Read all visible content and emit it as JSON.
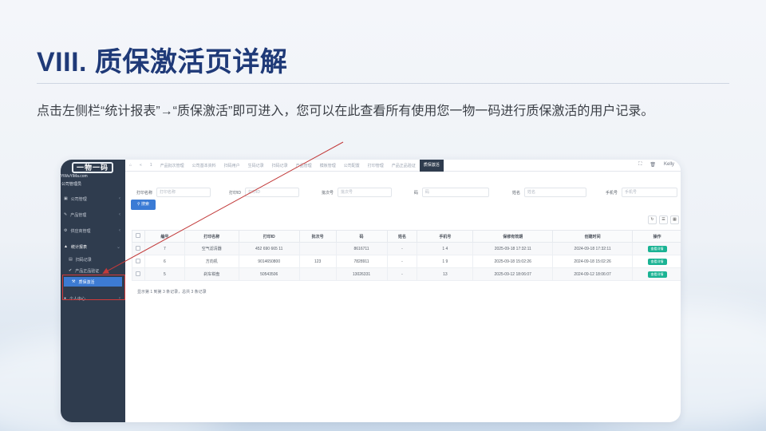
{
  "slide": {
    "title": "VIII. 质保激活页详解",
    "description": "点击左侧栏“统计报表”→“质保激活”即可进入，您可以在此查看所有使用您一物一码进行质保激活的用户记录。"
  },
  "app": {
    "logo_text": "一物一码",
    "logo_sub": "YiWuYiMa.com",
    "site_name": "公司管理员",
    "sidebar": {
      "items": [
        {
          "label": "公司管理",
          "icon": "building-icon"
        },
        {
          "label": "产品管理",
          "icon": "box-icon"
        },
        {
          "label": "供应商管理",
          "icon": "truck-icon"
        },
        {
          "label": "统计报表",
          "icon": "chart-icon"
        },
        {
          "label": "扫码记录",
          "icon": "scan-icon"
        },
        {
          "label": "产品正品验证",
          "icon": "verify-icon"
        },
        {
          "label": "质保激活",
          "icon": "wrench-icon"
        },
        {
          "label": "个人中心",
          "icon": "user-icon"
        }
      ]
    },
    "tabs": [
      "1",
      "产品批次管理",
      "公司基本资料",
      "扫码用户",
      "生码记录",
      "扫码记录",
      "产品管理",
      "模板管理",
      "公司配置",
      "打印管理",
      "产品正品验证",
      "质保激活"
    ],
    "user": "Kelly",
    "filters": [
      {
        "label": "打印名称",
        "placeholder": "打印名称"
      },
      {
        "label": "打印ID",
        "placeholder": "打印ID"
      },
      {
        "label": "批次号",
        "placeholder": "批次号"
      },
      {
        "label": "码",
        "placeholder": "码"
      },
      {
        "label": "姓名",
        "placeholder": "姓名"
      },
      {
        "label": "手机号",
        "placeholder": "手机号"
      }
    ],
    "search_label": "搜索",
    "table": {
      "columns": [
        "编号",
        "打印名称",
        "打印ID",
        "批次号",
        "码",
        "姓名",
        "手机号",
        "保修有效期",
        "创建时间",
        "操作"
      ],
      "rows": [
        {
          "id": "7",
          "name": "空气滤清器",
          "print_id": "452 690 665 11",
          "batch": "",
          "code": "8616711",
          "person": "-",
          "phone": "1          4",
          "warranty": "2025-09-18 17:32:11",
          "created": "2024-09-18 17:32:11",
          "action": "查看详情"
        },
        {
          "id": "6",
          "name": "方向机",
          "print_id": "9014650800",
          "batch": "123",
          "code": "7828911",
          "person": "-",
          "phone": "1          9",
          "warranty": "2025-09-18 15:02:26",
          "created": "2024-09-18 15:02:26",
          "action": "查看详情"
        },
        {
          "id": "5",
          "name": "刹车钳盘",
          "print_id": "50543506",
          "batch": "",
          "code": "13026331",
          "person": "-",
          "phone": "13",
          "warranty": "2025-09-12 18:06:07",
          "created": "2024-09-12 18:06:07",
          "action": "查看详情"
        }
      ]
    },
    "pager_text": "显示第 1 到第 3 条记录，总共 3 条记录"
  },
  "colors": {
    "title": "#1f3a78",
    "sidebar": "#2f3c4e",
    "active": "#3d7bd3",
    "highlight": "#d13a3a",
    "action": "#1ab394"
  }
}
